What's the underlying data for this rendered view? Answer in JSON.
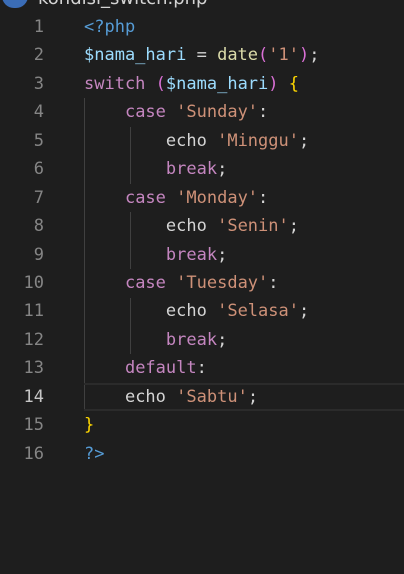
{
  "tab": {
    "title": "kondisi_switch.php"
  },
  "editor": {
    "active_line": 14,
    "lines": [
      {
        "n": "1",
        "tokens": [
          {
            "t": "<?php",
            "c": "tag"
          }
        ]
      },
      {
        "n": "2",
        "tokens": [
          {
            "t": "$nama_hari",
            "c": "var"
          },
          {
            "t": " = ",
            "c": "plain"
          },
          {
            "t": "date",
            "c": "fn"
          },
          {
            "t": "(",
            "c": "paren2"
          },
          {
            "t": "'1'",
            "c": "str"
          },
          {
            "t": ")",
            "c": "paren2"
          },
          {
            "t": ";",
            "c": "plain"
          }
        ]
      },
      {
        "n": "3",
        "tokens": [
          {
            "t": "switch",
            "c": "kw"
          },
          {
            "t": " ",
            "c": "plain"
          },
          {
            "t": "(",
            "c": "paren2"
          },
          {
            "t": "$nama_hari",
            "c": "var"
          },
          {
            "t": ")",
            "c": "paren2"
          },
          {
            "t": " ",
            "c": "plain"
          },
          {
            "t": "{",
            "c": "paren"
          }
        ]
      },
      {
        "n": "4",
        "tokens": [
          {
            "t": "    ",
            "c": "plain"
          },
          {
            "t": "case",
            "c": "kw"
          },
          {
            "t": " ",
            "c": "plain"
          },
          {
            "t": "'Sunday'",
            "c": "str"
          },
          {
            "t": ":",
            "c": "plain"
          }
        ]
      },
      {
        "n": "5",
        "tokens": [
          {
            "t": "        ",
            "c": "plain"
          },
          {
            "t": "echo",
            "c": "plain"
          },
          {
            "t": " ",
            "c": "plain"
          },
          {
            "t": "'Minggu'",
            "c": "str"
          },
          {
            "t": ";",
            "c": "plain"
          }
        ]
      },
      {
        "n": "6",
        "tokens": [
          {
            "t": "        ",
            "c": "plain"
          },
          {
            "t": "break",
            "c": "kw"
          },
          {
            "t": ";",
            "c": "plain"
          }
        ]
      },
      {
        "n": "7",
        "tokens": [
          {
            "t": "    ",
            "c": "plain"
          },
          {
            "t": "case",
            "c": "kw"
          },
          {
            "t": " ",
            "c": "plain"
          },
          {
            "t": "'Monday'",
            "c": "str"
          },
          {
            "t": ":",
            "c": "plain"
          }
        ]
      },
      {
        "n": "8",
        "tokens": [
          {
            "t": "        ",
            "c": "plain"
          },
          {
            "t": "echo",
            "c": "plain"
          },
          {
            "t": " ",
            "c": "plain"
          },
          {
            "t": "'Senin'",
            "c": "str"
          },
          {
            "t": ";",
            "c": "plain"
          }
        ]
      },
      {
        "n": "9",
        "tokens": [
          {
            "t": "        ",
            "c": "plain"
          },
          {
            "t": "break",
            "c": "kw"
          },
          {
            "t": ";",
            "c": "plain"
          }
        ]
      },
      {
        "n": "10",
        "tokens": [
          {
            "t": "    ",
            "c": "plain"
          },
          {
            "t": "case",
            "c": "kw"
          },
          {
            "t": " ",
            "c": "plain"
          },
          {
            "t": "'Tuesday'",
            "c": "str"
          },
          {
            "t": ":",
            "c": "plain"
          }
        ]
      },
      {
        "n": "11",
        "tokens": [
          {
            "t": "        ",
            "c": "plain"
          },
          {
            "t": "echo",
            "c": "plain"
          },
          {
            "t": " ",
            "c": "plain"
          },
          {
            "t": "'Selasa'",
            "c": "str"
          },
          {
            "t": ";",
            "c": "plain"
          }
        ]
      },
      {
        "n": "12",
        "tokens": [
          {
            "t": "        ",
            "c": "plain"
          },
          {
            "t": "break",
            "c": "kw"
          },
          {
            "t": ";",
            "c": "plain"
          }
        ]
      },
      {
        "n": "13",
        "tokens": [
          {
            "t": "    ",
            "c": "plain"
          },
          {
            "t": "default",
            "c": "kw"
          },
          {
            "t": ":",
            "c": "plain"
          }
        ]
      },
      {
        "n": "14",
        "tokens": [
          {
            "t": "    ",
            "c": "plain"
          },
          {
            "t": "echo",
            "c": "plain"
          },
          {
            "t": " ",
            "c": "plain"
          },
          {
            "t": "'Sabtu'",
            "c": "str"
          },
          {
            "t": ";",
            "c": "plain"
          }
        ]
      },
      {
        "n": "15",
        "tokens": [
          {
            "t": "}",
            "c": "paren"
          }
        ]
      },
      {
        "n": "16",
        "tokens": [
          {
            "t": "?>",
            "c": "tag"
          }
        ]
      }
    ]
  }
}
